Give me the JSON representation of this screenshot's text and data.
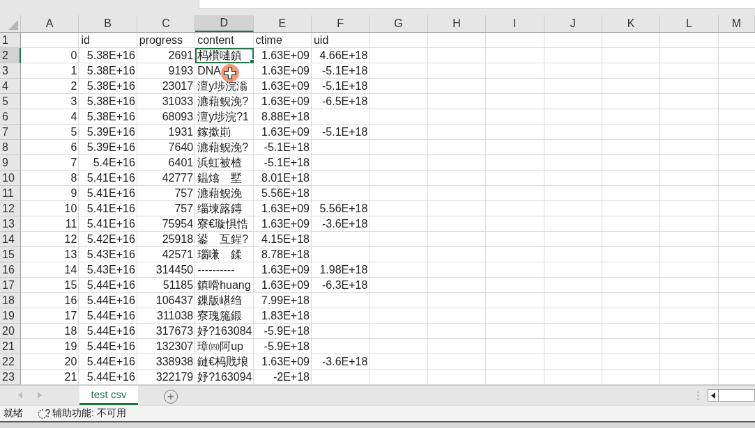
{
  "columns": [
    {
      "label": "A",
      "selected": false
    },
    {
      "label": "B",
      "selected": false
    },
    {
      "label": "C",
      "selected": false
    },
    {
      "label": "D",
      "selected": true
    },
    {
      "label": "E",
      "selected": false
    },
    {
      "label": "F",
      "selected": false
    },
    {
      "label": "G",
      "selected": false
    },
    {
      "label": "H",
      "selected": false
    },
    {
      "label": "I",
      "selected": false
    },
    {
      "label": "J",
      "selected": false
    },
    {
      "label": "K",
      "selected": false
    },
    {
      "label": "L",
      "selected": false
    },
    {
      "label": "M",
      "selected": false
    }
  ],
  "header_row": {
    "number": "1",
    "selected": false,
    "cells": {
      "b": "id",
      "c": "progress",
      "d": "content",
      "e": "ctime",
      "f": "uid"
    }
  },
  "rows": [
    {
      "number": "2",
      "selected": true,
      "cells": {
        "a": "0",
        "b": "5.38E+16",
        "c": "2691",
        "d": "杩欑嗹鎮",
        "e": "1.63E+09",
        "f": "4.66E+18"
      }
    },
    {
      "number": "3",
      "selected": false,
      "cells": {
        "a": "1",
        "b": "5.38E+16",
        "c": "9193",
        "d": "DNA",
        "e": "1.63E+09",
        "f": "-5.1E+18"
      }
    },
    {
      "number": "4",
      "selected": false,
      "cells": {
        "a": "2",
        "b": "5.38E+16",
        "c": "23017",
        "d": "澶у埗浣滃",
        "e": "1.63E+09",
        "f": "-5.1E+18"
      }
    },
    {
      "number": "5",
      "selected": false,
      "cells": {
        "a": "3",
        "b": "5.38E+16",
        "c": "31033",
        "d": "瀌藉鲵浼?",
        "e": "1.63E+09",
        "f": "-6.5E+18"
      }
    },
    {
      "number": "6",
      "selected": false,
      "cells": {
        "a": "4",
        "b": "5.38E+16",
        "c": "68093",
        "d": "澶у埗浣?1",
        "e": "8.88E+18"
      }
    },
    {
      "number": "7",
      "selected": false,
      "cells": {
        "a": "5",
        "b": "5.39E+16",
        "c": "1931",
        "d": "鎵撳崱",
        "e": "1.63E+09",
        "f": "-5.1E+18"
      }
    },
    {
      "number": "8",
      "selected": false,
      "cells": {
        "a": "6",
        "b": "5.39E+16",
        "c": "7640",
        "d": "瀌藉鲵浼?",
        "e": "-5.1E+18"
      }
    },
    {
      "number": "9",
      "selected": false,
      "cells": {
        "a": "7",
        "b": "5.4E+16",
        "c": "6401",
        "d": "浜虹被楂",
        "e": "-5.1E+18"
      }
    },
    {
      "number": "10",
      "selected": false,
      "cells": {
        "a": "8",
        "b": "5.41E+16",
        "c": "42777",
        "d": "鎾熻　墅",
        "e": "8.01E+18"
      }
    },
    {
      "number": "11",
      "selected": false,
      "cells": {
        "a": "9",
        "b": "5.41E+16",
        "c": "757",
        "d": "瀌藉鲵浼",
        "e": "5.56E+18"
      }
    },
    {
      "number": "12",
      "selected": false,
      "cells": {
        "a": "10",
        "b": "5.41E+16",
        "c": "757",
        "d": "缁堜簬鏄",
        "e": "1.63E+09",
        "f": "5.56E+18"
      }
    },
    {
      "number": "13",
      "selected": false,
      "cells": {
        "a": "11",
        "b": "5.41E+16",
        "c": "75954",
        "d": "寮€璇惧悎",
        "e": "1.63E+09",
        "f": "-3.6E+18"
      }
    },
    {
      "number": "14",
      "selected": false,
      "cells": {
        "a": "12",
        "b": "5.42E+16",
        "c": "25918",
        "d": "鍙　互鍟?",
        "e": "4.15E+18"
      }
    },
    {
      "number": "15",
      "selected": false,
      "cells": {
        "a": "13",
        "b": "5.43E+16",
        "c": "42571",
        "d": "瑙嗛　鍒",
        "e": "8.78E+18"
      }
    },
    {
      "number": "16",
      "selected": false,
      "cells": {
        "a": "14",
        "b": "5.43E+16",
        "c": "314450",
        "d": "----------",
        "e": "1.63E+09",
        "f": "1.98E+18"
      }
    },
    {
      "number": "17",
      "selected": false,
      "cells": {
        "a": "15",
        "b": "5.44E+16",
        "c": "51185",
        "d": "鎮嗗huang",
        "e": "1.63E+09",
        "f": "-6.3E+18"
      }
    },
    {
      "number": "18",
      "selected": false,
      "cells": {
        "a": "16",
        "b": "5.44E+16",
        "c": "106437",
        "d": "鏁版嵁绉",
        "e": "7.99E+18"
      }
    },
    {
      "number": "19",
      "selected": false,
      "cells": {
        "a": "17",
        "b": "5.44E+16",
        "c": "311038",
        "d": "寮瑰箷鍛",
        "e": "1.83E+18"
      }
    },
    {
      "number": "20",
      "selected": false,
      "cells": {
        "a": "18",
        "b": "5.44E+16",
        "c": "317673",
        "d": "妤?163084",
        "e": "-5.9E+18"
      }
    },
    {
      "number": "21",
      "selected": false,
      "cells": {
        "a": "19",
        "b": "5.44E+16",
        "c": "132307",
        "d": "璋㈣阿up",
        "e": "-5.9E+18"
      }
    },
    {
      "number": "22",
      "selected": false,
      "cells": {
        "a": "20",
        "b": "5.44E+16",
        "c": "338938",
        "d": "鏈€杩戝埌",
        "e": "1.63E+09",
        "f": "-3.6E+18"
      }
    },
    {
      "number": "23",
      "selected": false,
      "cells": {
        "a": "21",
        "b": "5.44E+16",
        "c": "322179",
        "d": "妤?163094",
        "e": "-2E+18"
      }
    }
  ],
  "sheet_tabs": [
    {
      "label": "test csv",
      "selected": true
    }
  ],
  "add_sheet": "+",
  "status_bar": {
    "ready": "就绪",
    "accessibility": "辅助功能: 不可用"
  }
}
